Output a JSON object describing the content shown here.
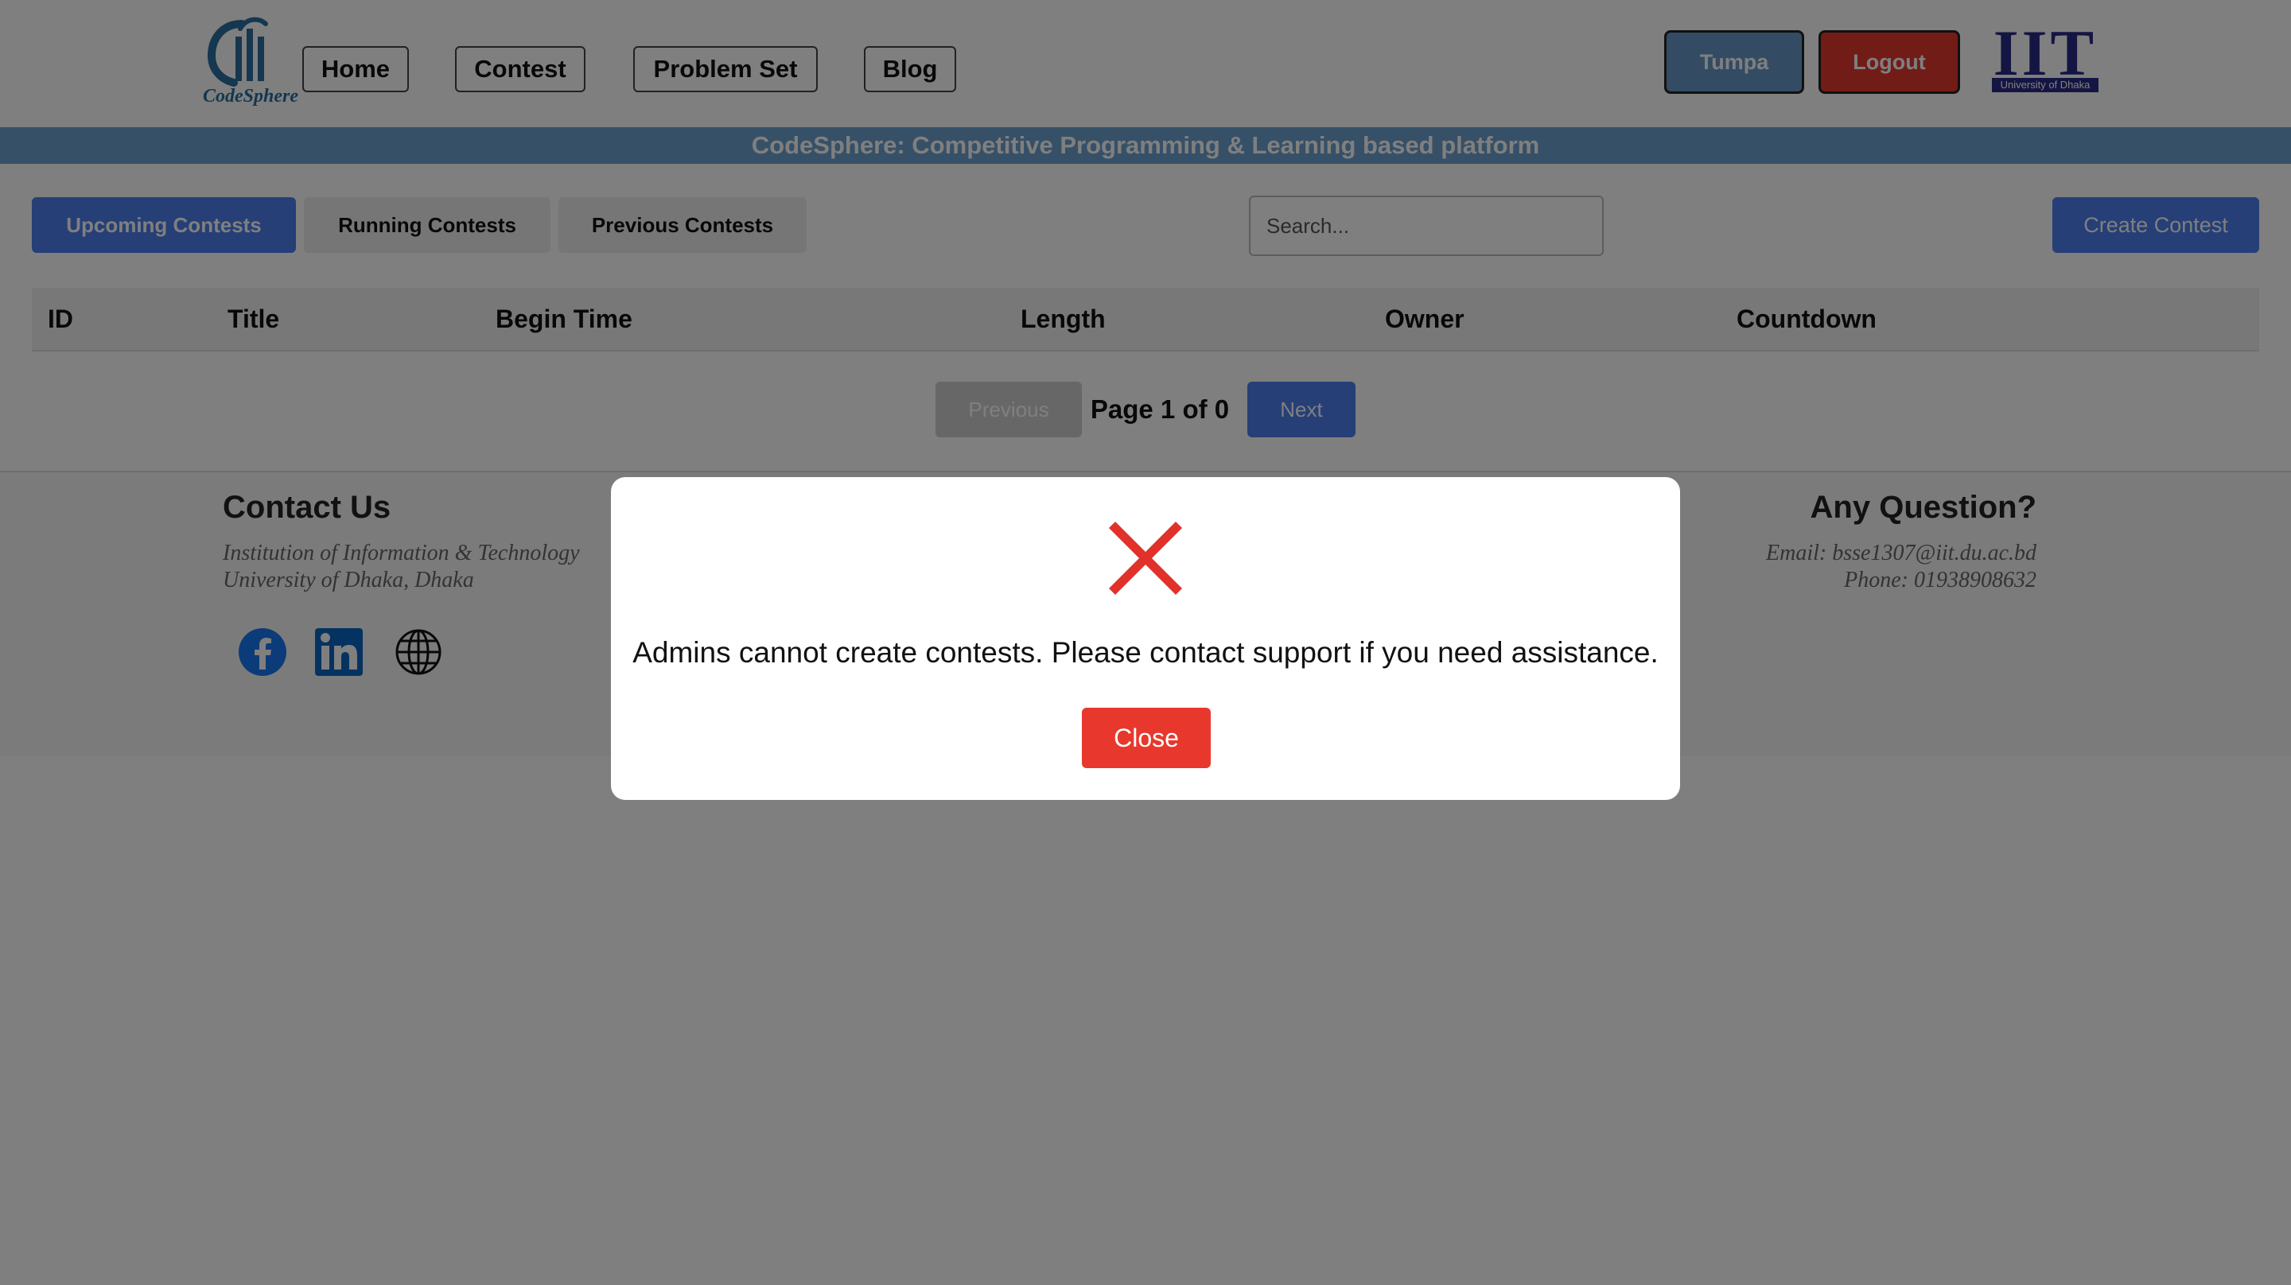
{
  "header": {
    "logo_text": "CodeSphere",
    "nav": [
      "Home",
      "Contest",
      "Problem Set",
      "Blog"
    ],
    "user_label": "Tumpa",
    "logout_label": "Logout",
    "iit_letters": "IIT",
    "iit_subtitle": "University of Dhaka"
  },
  "banner": {
    "text": "CodeSphere: Competitive Programming & Learning based platform"
  },
  "tabs": [
    "Upcoming Contests",
    "Running Contests",
    "Previous Contests"
  ],
  "search": {
    "placeholder": "Search..."
  },
  "create_contest_label": "Create Contest",
  "table": {
    "headers": [
      "ID",
      "Title",
      "Begin Time",
      "Length",
      "Owner",
      "Countdown"
    ]
  },
  "pagination": {
    "prev_label": "Previous",
    "page_text": "Page 1 of 0",
    "next_label": "Next"
  },
  "footer": {
    "contact_title": "Contact Us",
    "contact_lines": [
      "Institution of Information & Technology",
      "University of Dhaka, Dhaka"
    ],
    "question_title": "Any Question?",
    "question_lines": [
      "Email: bsse1307@iit.du.ac.bd",
      "Phone: 01938908632"
    ],
    "social_icons": [
      "facebook-icon",
      "linkedin-icon",
      "globe-icon"
    ]
  },
  "modal": {
    "icon": "error-x-icon",
    "message": "Admins cannot create contests. Please contact support if you need assistance.",
    "close_label": "Close"
  },
  "colors": {
    "accent": "#4d7fee",
    "danger": "#e8382d",
    "banner": "#6da0cf",
    "user_button": "#6699c8",
    "logout_button": "#e4382f",
    "iit_brand": "#2b2a86"
  }
}
